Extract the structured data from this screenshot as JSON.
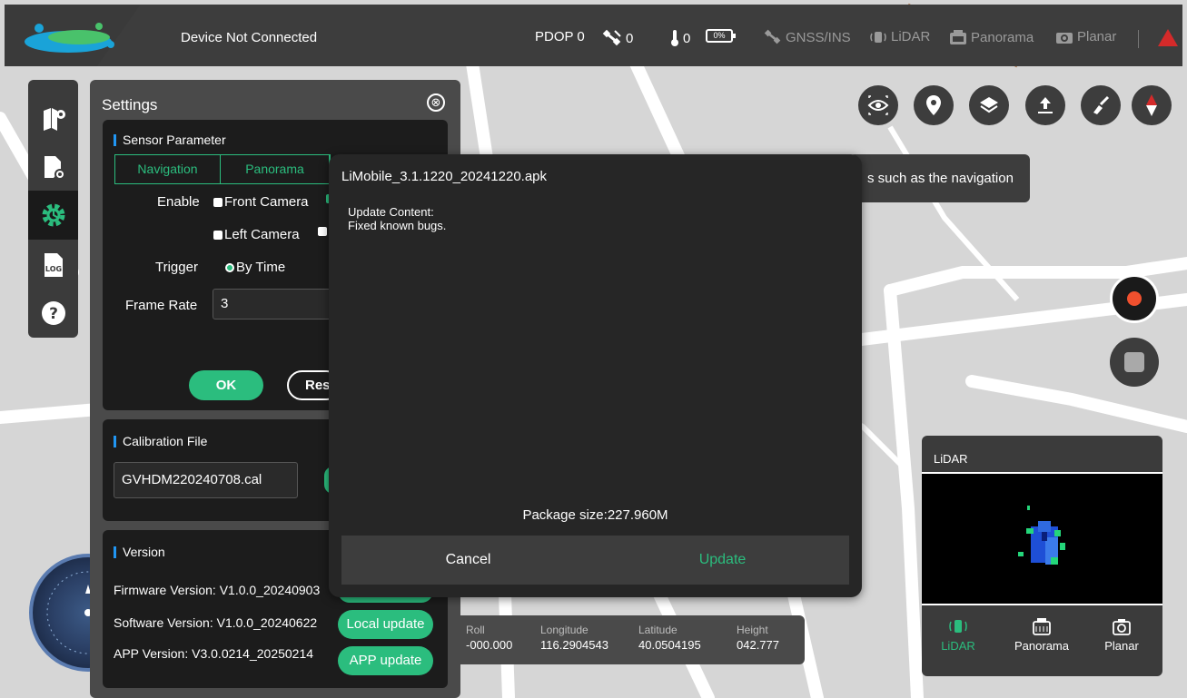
{
  "topbar": {
    "connection_status": "Device Not Connected",
    "pdop": "PDOP 0",
    "satellites": "0",
    "temperature": "0",
    "battery": "0%",
    "gnss": "GNSS/INS",
    "lidar": "LiDAR",
    "panorama": "Panorama",
    "planar": "Planar"
  },
  "sidenav": {
    "items": [
      {
        "icon": "map-settings-icon"
      },
      {
        "icon": "file-settings-icon"
      },
      {
        "icon": "gear-icon",
        "active": true
      },
      {
        "icon": "log-icon",
        "label": "LOG"
      },
      {
        "icon": "help-icon",
        "label": "?"
      }
    ]
  },
  "settings": {
    "title": "Settings",
    "close_icon": "⊗",
    "sensor": {
      "title": "Sensor Parameter",
      "tabs": [
        "Navigation",
        "Panorama"
      ],
      "enable_label": "Enable",
      "front_camera": "Front Camera",
      "left_camera": "Left Camera",
      "trigger_label": "Trigger",
      "trigger_value": "By Time",
      "frame_rate_label": "Frame Rate",
      "frame_rate_value": "3",
      "ok_label": "OK",
      "reset_label": "Res"
    },
    "calibration": {
      "title": "Calibration File",
      "file": "GVHDM220240708.cal"
    },
    "version": {
      "title": "Version",
      "firmware": "Firmware Version: V1.0.0_20240903",
      "software": "Software Version: V1.0.0_20240622",
      "app": "APP Version: V3.0.0214_20250214",
      "local_update": "Local update",
      "app_update": "APP update"
    }
  },
  "tooltip": {
    "text": "s such as the navigation"
  },
  "lidar_panel": {
    "title": "LiDAR",
    "tabs": [
      "LiDAR",
      "Panorama",
      "Planar"
    ]
  },
  "telemetry": {
    "roll_label": "Roll",
    "roll": "-000.000",
    "lon_label": "Longitude",
    "lon": "116.2904543",
    "lat_label": "Latitude",
    "lat": "40.0504195",
    "height_label": "Height",
    "height": "042.777"
  },
  "modal": {
    "title": "LiMobile_3.1.1220_20241220.apk",
    "content_label": "Update Content:",
    "content": "Fixed known bugs.",
    "package_size": "Package size:227.960M",
    "cancel": "Cancel",
    "update": "Update"
  },
  "colors": {
    "accent": "#2bbd7e",
    "topbar": "#3d3d3d",
    "panel": "#4a4a4a",
    "card": "#1c1c1c",
    "warning": "#d42a2a",
    "record": "#f0502e"
  }
}
